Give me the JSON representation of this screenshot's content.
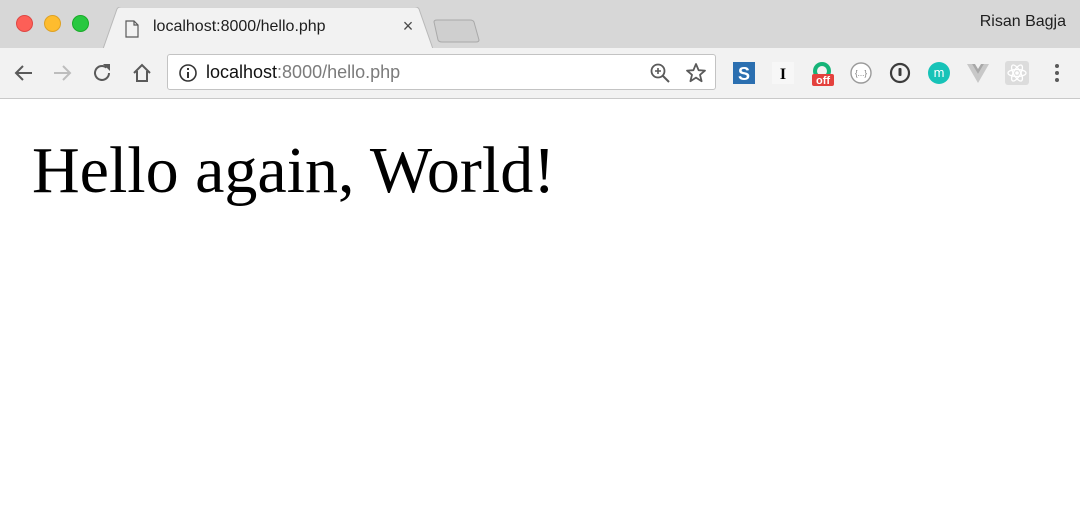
{
  "browser": {
    "tab": {
      "title": "localhost:8000/hello.php",
      "close_label": "×"
    },
    "profile_name": "Risan Bagja",
    "address": {
      "host": "localhost",
      "path": ":8000/hello.php"
    },
    "extensions": [
      "s-extension-icon",
      "i-extension-icon",
      "grammarly-off-icon",
      "json-extension-icon",
      "password-extension-icon",
      "m-extension-icon",
      "vue-devtools-icon",
      "react-devtools-icon"
    ],
    "extension_labels": {
      "s": "S",
      "i": "I",
      "off": "off",
      "json": "{...}",
      "m": "m"
    }
  },
  "page": {
    "heading": "Hello again, World!"
  }
}
